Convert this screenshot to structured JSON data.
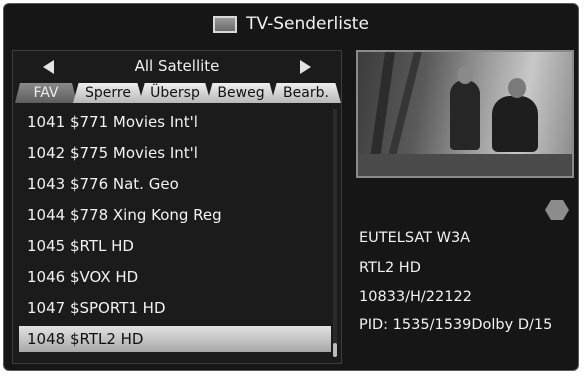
{
  "window": {
    "title": "TV-Senderliste",
    "title_icon": "tv-icon"
  },
  "satellite_selector": {
    "label": "All Satellite",
    "left_icon": "arrow-left-icon",
    "right_icon": "arrow-right-icon"
  },
  "tabs": [
    {
      "label": "FAV",
      "active": true
    },
    {
      "label": "Sperre",
      "active": false
    },
    {
      "label": "Übersp",
      "active": false
    },
    {
      "label": "Beweg",
      "active": false
    },
    {
      "label": "Bearb.",
      "active": false
    }
  ],
  "channels": [
    {
      "label": "1041 $771 Movies Int'l",
      "selected": false
    },
    {
      "label": "1042 $775 Movies Int'l",
      "selected": false
    },
    {
      "label": "1043 $776 Nat. Geo",
      "selected": false
    },
    {
      "label": "1044 $778 Xing Kong Reg",
      "selected": false
    },
    {
      "label": "1045 $RTL HD",
      "selected": false
    },
    {
      "label": "1046 $VOX HD",
      "selected": false
    },
    {
      "label": "1047 $SPORT1 HD",
      "selected": false
    },
    {
      "label": "1048 $RTL2 HD",
      "selected": true
    }
  ],
  "info": {
    "satellite": "EUTELSAT W3A",
    "channel": "RTL2 HD",
    "transponder": "10833/H/22122",
    "pid": "PID: 1535/1539Dolby D/15"
  },
  "colors": {
    "background": "#161616",
    "text": "#f2f2f2",
    "selection": "#c4c4c4"
  }
}
